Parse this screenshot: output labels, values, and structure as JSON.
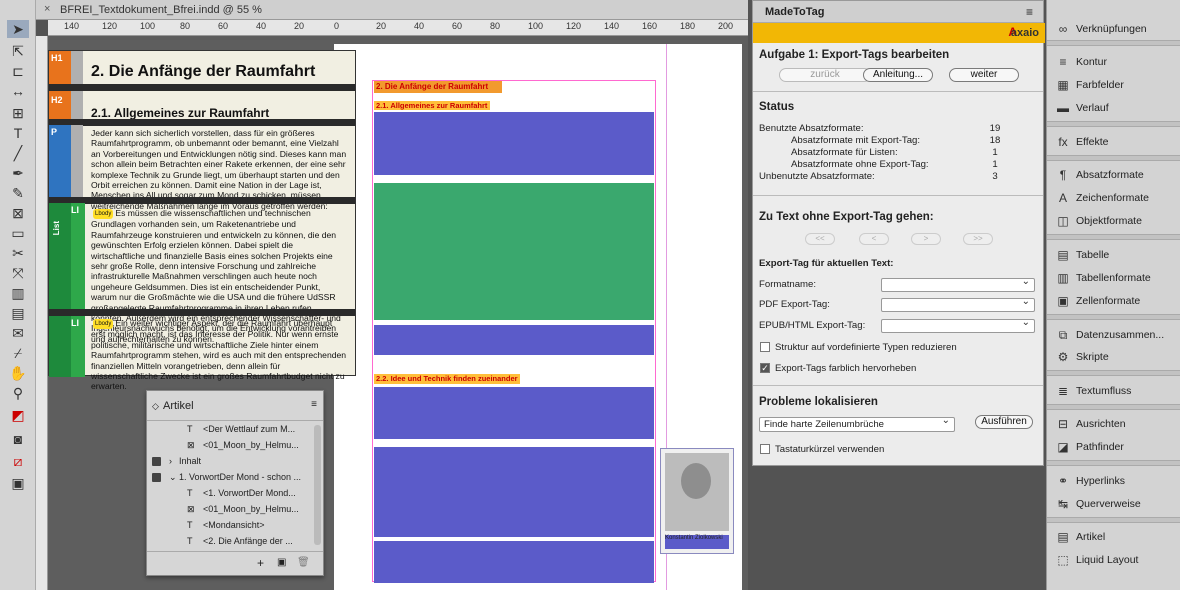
{
  "document": {
    "tab_title": "BFREI_Textdokument_Bfrei.indd @ 55 %",
    "close": "×"
  },
  "ruler": [
    "140",
    "120",
    "100",
    "80",
    "60",
    "40",
    "20",
    "0",
    "20",
    "40",
    "60",
    "80",
    "100",
    "120",
    "140",
    "160",
    "180",
    "200"
  ],
  "story_editor": {
    "tags": {
      "h1": "H1",
      "h2": "H2",
      "p": "P",
      "list": "List",
      "li": "LI"
    },
    "heading1": "2. Die Anfänge der Raumfahrt",
    "heading2": "2.1. Allgemeines zur Raumfahrt",
    "paragraph": "Jeder kann sich sicherlich vorstellen, dass für ein größeres Raumfahrtprogramm, ob unbemannt oder bemannt, eine Vielzahl an Vorbereitungen und Entwicklungen nötig sind. Dieses kann man schon allein beim Betrachten einer Rakete erkennen, der eine sehr komplexe Technik zu Grunde liegt, um überhaupt starten und den Orbit erreichen zu können. Damit eine Nation in der Lage ist, Menschen ins All und sogar zum Mond zu schicken, müssen weitreichende Maßnahmen lange im Voraus getroffen werden:",
    "bullet_badge": "Lbody",
    "item1": "Es müssen die wissenschaftlichen und technischen Grundlagen vorhanden sein, um Raketenantriebe und Raumfahrzeuge konstruieren und entwickeln zu können, die den gewünschten Erfolg erzielen können. Dabei spielt die wirtschaftliche und finanzielle Basis eines solchen Projekts eine sehr große Rolle, denn intensive Forschung und zahlreiche infrastrukturelle Maßnahmen verschlingen auch heute noch ungeheure Geldsummen. Dies ist ein entscheidender Punkt, warum nur die Großmächte wie die USA und die frühere UdSSR großangelegte Raumfahrtprogramme in ihren Leben rufen konnten. Außerdem wird ein entsprechender Wissenschafter- und Ingenieursnachwuchs benötigt, um die Entwicklung vorantreiben und aufrechterhalten zu können.",
    "item2": "Ein weiter wichtiger Aspekt, der die Raumfahrt überhaupt erst möglich macht, ist das Interesse der Politik. Nur wenn ernste politische, militärische und wirtschaftliche Ziele hinter einem Raumfahrtprogramm stehen, wird es auch mit den entsprechenden finanziellen Mitteln vorangetrieben, denn allein für wissenschaftliche Zwecke ist ein großes Raumfahrtbudget nicht zu erwarten."
  },
  "layout_page": {
    "heading1": "2. Die Anfänge der Raumfahrt",
    "heading2": "2.1. Allgemeines zur Raumfahrt",
    "heading3": "2.2. Idee und Technik finden zueinander",
    "photo_caption": "Konstantin Ziolkowski",
    "highlight_colors": {
      "body": "#5b5bc9",
      "list": "#3aa86e",
      "heading": "#f29a2e",
      "subheading": "#ffbf3a"
    }
  },
  "articles_panel": {
    "title": "Artikel",
    "rows": [
      {
        "label": "<Der Wettlauf zum M...",
        "icon": "T"
      },
      {
        "label": "<01_Moon_by_Helmu...",
        "icon": "⊠"
      },
      {
        "label": "Inhalt",
        "icon": ""
      },
      {
        "label": "1. VorwortDer Mond - schon ...",
        "icon": ""
      },
      {
        "label": "<1. VorwortDer Mond...",
        "icon": "T"
      },
      {
        "label": "<01_Moon_by_Helmu...",
        "icon": "⊠"
      },
      {
        "label": "<Mondansicht>",
        "icon": "T"
      },
      {
        "label": "<2. Die Anfänge der ...",
        "icon": "T"
      }
    ],
    "footer": {
      "add": "+",
      "new": "▣",
      "delete": "🗑"
    }
  },
  "madetotag": {
    "panel_title": "MadeToTag",
    "brand": "axaio",
    "task_title": "Aufgabe 1: Export-Tags bearbeiten",
    "back": "zurück",
    "guide": "Anleitung...",
    "next": "weiter",
    "status_title": "Status",
    "status": [
      {
        "label": "Benutzte Absatzformate:",
        "value": "19",
        "indent": false
      },
      {
        "label": "Absatzformate mit Export-Tag:",
        "value": "18",
        "indent": true
      },
      {
        "label": "Absatzformate für Listen:",
        "value": "1",
        "indent": true
      },
      {
        "label": "Absatzformate ohne Export-Tag:",
        "value": "1",
        "indent": true
      },
      {
        "label": "Unbenutzte Absatzformate:",
        "value": "3",
        "indent": false
      }
    ],
    "goto_title": "Zu Text ohne Export-Tag gehen:",
    "nav": [
      "<<",
      "<",
      ">",
      ">>"
    ],
    "current_tag_title": "Export-Tag für aktuellen Text:",
    "fields": {
      "format_name": "Formatname:",
      "pdf_tag": "PDF Export-Tag:",
      "epub_tag": "EPUB/HTML Export-Tag:"
    },
    "reduce_label": "Struktur auf vordefinierte Typen reduzieren",
    "color_label": "Export-Tags farblich hervorheben",
    "problems_title": "Probleme lokalisieren",
    "problem_select": "Finde harte Zeilenumbrüche",
    "run": "Ausführen",
    "shortcut_label": "Tastaturkürzel verwenden"
  },
  "right_panel": [
    {
      "label": "Verknüpfungen",
      "icon": "∞"
    },
    {
      "label": "Kontur",
      "icon": "≡"
    },
    {
      "label": "Farbfelder",
      "icon": "▦"
    },
    {
      "label": "Verlauf",
      "icon": "▬"
    },
    {
      "label": "Effekte",
      "icon": "fx"
    },
    {
      "label": "Absatzformate",
      "icon": "¶"
    },
    {
      "label": "Zeichenformate",
      "icon": "A"
    },
    {
      "label": "Objektformate",
      "icon": "◫"
    },
    {
      "label": "Tabelle",
      "icon": "▤"
    },
    {
      "label": "Tabellenformate",
      "icon": "▥"
    },
    {
      "label": "Zellenformate",
      "icon": "▣"
    },
    {
      "label": "Datenzusammen...",
      "icon": "⧉"
    },
    {
      "label": "Skripte",
      "icon": "⚙"
    },
    {
      "label": "Textumfluss",
      "icon": "≣"
    },
    {
      "label": "Ausrichten",
      "icon": "⊟"
    },
    {
      "label": "Pathfinder",
      "icon": "◪"
    },
    {
      "label": "Hyperlinks",
      "icon": "⚭"
    },
    {
      "label": "Querverweise",
      "icon": "↹"
    },
    {
      "label": "Artikel",
      "icon": "▤"
    },
    {
      "label": "Liquid Layout",
      "icon": "⬚"
    }
  ]
}
